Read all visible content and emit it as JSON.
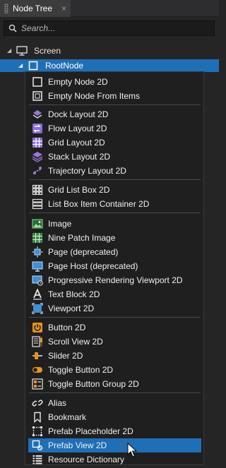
{
  "tab": {
    "title": "Node Tree",
    "close": "×"
  },
  "search": {
    "placeholder": "Search..."
  },
  "tree": {
    "screen_label": "Screen",
    "root_label": "RootNode"
  },
  "menu": {
    "items": [
      {
        "label": "Empty Node 2D",
        "icon": "empty-node-icon"
      },
      {
        "label": "Empty Node From Items",
        "icon": "empty-node-items-icon"
      },
      {
        "label": "Dock Layout 2D",
        "icon": "dock-layout-icon"
      },
      {
        "label": "Flow Layout 2D",
        "icon": "flow-layout-icon"
      },
      {
        "label": "Grid Layout 2D",
        "icon": "grid-layout-icon"
      },
      {
        "label": "Stack Layout 2D",
        "icon": "stack-layout-icon"
      },
      {
        "label": "Trajectory Layout 2D",
        "icon": "trajectory-layout-icon"
      },
      {
        "label": "Grid List Box 2D",
        "icon": "grid-list-box-icon"
      },
      {
        "label": "List Box Item Container 2D",
        "icon": "list-box-item-icon"
      },
      {
        "label": "Image",
        "icon": "image-icon"
      },
      {
        "label": "Nine Patch Image",
        "icon": "nine-patch-icon"
      },
      {
        "label": "Page (deprecated)",
        "icon": "page-icon"
      },
      {
        "label": "Page Host (deprecated)",
        "icon": "page-host-icon"
      },
      {
        "label": "Progressive Rendering Viewport 2D",
        "icon": "progressive-viewport-icon"
      },
      {
        "label": "Text Block 2D",
        "icon": "text-block-icon"
      },
      {
        "label": "Viewport 2D",
        "icon": "viewport-icon"
      },
      {
        "label": "Button 2D",
        "icon": "button-icon"
      },
      {
        "label": "Scroll View 2D",
        "icon": "scroll-view-icon"
      },
      {
        "label": "Slider 2D",
        "icon": "slider-icon"
      },
      {
        "label": "Toggle Button 2D",
        "icon": "toggle-button-icon"
      },
      {
        "label": "Toggle Button Group 2D",
        "icon": "toggle-group-icon"
      },
      {
        "label": "Alias",
        "icon": "alias-icon"
      },
      {
        "label": "Bookmark",
        "icon": "bookmark-icon"
      },
      {
        "label": "Prefab Placeholder 2D",
        "icon": "prefab-placeholder-icon"
      },
      {
        "label": "Prefab View 2D",
        "icon": "prefab-view-icon"
      },
      {
        "label": "Resource Dictionary",
        "icon": "resource-dictionary-icon"
      }
    ],
    "highlighted": "Prefab View 2D",
    "accent_color": "#1f6fb7"
  }
}
